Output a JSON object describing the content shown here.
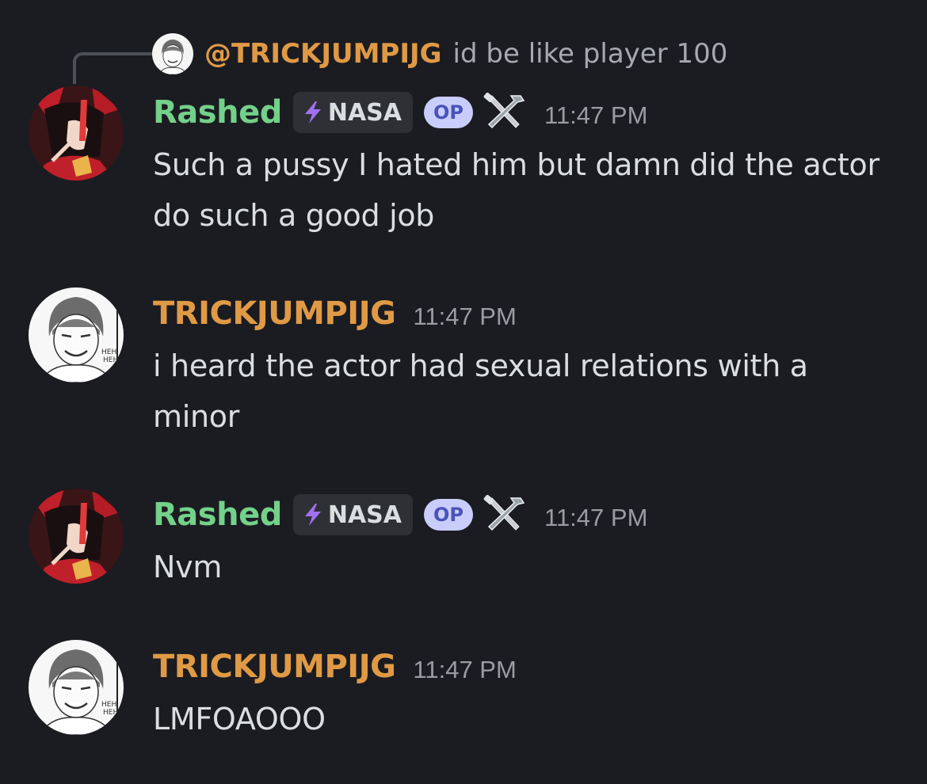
{
  "reply": {
    "author": "@TRICKJUMPIJG",
    "text": "id be like player 100"
  },
  "messages": [
    {
      "author": "Rashed",
      "author_color": "#73d18a",
      "tag": "NASA",
      "op_badge": "OP",
      "role_icon": "tools-icon",
      "time": "11:47 PM",
      "text": "Such a pussy I hated him but damn did the actor do such a good job"
    },
    {
      "author": "TRICKJUMPIJG",
      "author_color": "#e09a45",
      "time": "11:47 PM",
      "text": "i heard the actor had sexual relations with a minor"
    },
    {
      "author": "Rashed",
      "author_color": "#73d18a",
      "tag": "NASA",
      "op_badge": "OP",
      "role_icon": "tools-icon",
      "time": "11:47 PM",
      "text": "Nvm"
    },
    {
      "author": "TRICKJUMPIJG",
      "author_color": "#e09a45",
      "time": "11:47 PM",
      "text": "LMFOAOOO"
    }
  ]
}
